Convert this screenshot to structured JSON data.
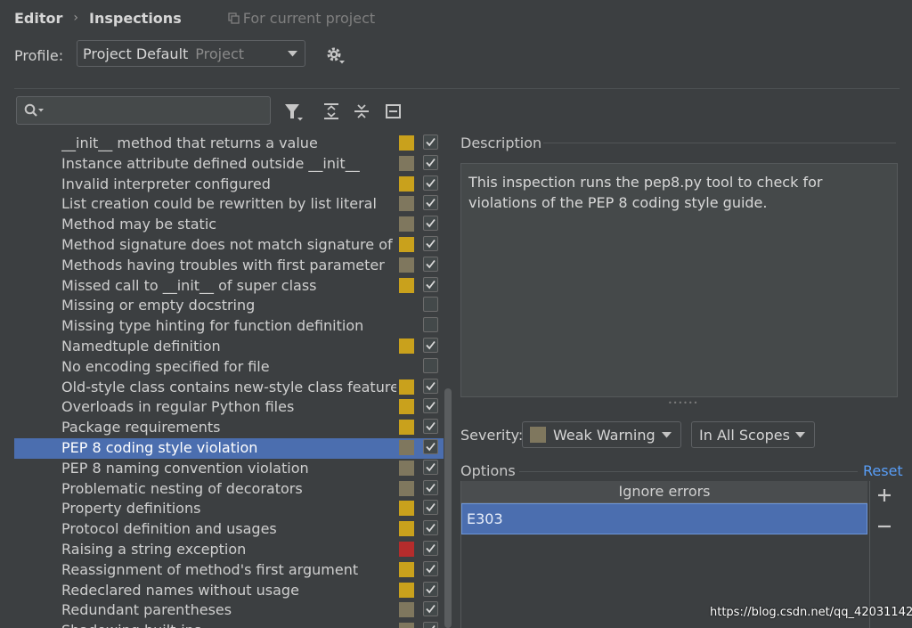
{
  "breadcrumb": {
    "editor": "Editor",
    "inspections": "Inspections",
    "scope_note": "For current project"
  },
  "profile": {
    "label": "Profile:",
    "value": "Project Default",
    "scope": "Project"
  },
  "search": {
    "placeholder": ""
  },
  "toolbar": {
    "icons": [
      "filter-icon",
      "expand-all-icon",
      "collapse-all-icon",
      "reset-icon"
    ]
  },
  "colors": {
    "warning": "#c9a11c",
    "weak_warning": "#7f775e",
    "error": "#b52c2c",
    "selection": "#4b6eaf",
    "link": "#589df6"
  },
  "inspections": [
    {
      "label": "__init__ method that returns a value",
      "severity": "warning",
      "checked": true
    },
    {
      "label": "Instance attribute defined outside __init__",
      "severity": "weak_warning",
      "checked": true
    },
    {
      "label": "Invalid interpreter configured",
      "severity": "warning",
      "checked": true
    },
    {
      "label": "List creation could be rewritten by list literal",
      "severity": "weak_warning",
      "checked": true
    },
    {
      "label": "Method may be static",
      "severity": "weak_warning",
      "checked": true
    },
    {
      "label": "Method signature does not match signature of o",
      "severity": "warning",
      "checked": true
    },
    {
      "label": "Methods having troubles with first parameter",
      "severity": "weak_warning",
      "checked": true
    },
    {
      "label": "Missed call to __init__ of super class",
      "severity": "warning",
      "checked": true
    },
    {
      "label": "Missing or empty docstring",
      "severity": "none",
      "checked": false
    },
    {
      "label": "Missing type hinting for function definition",
      "severity": "none",
      "checked": false
    },
    {
      "label": "Namedtuple definition",
      "severity": "warning",
      "checked": true
    },
    {
      "label": "No encoding specified for file",
      "severity": "none",
      "checked": false
    },
    {
      "label": "Old-style class contains new-style class features",
      "severity": "warning",
      "checked": true
    },
    {
      "label": "Overloads in regular Python files",
      "severity": "warning",
      "checked": true
    },
    {
      "label": "Package requirements",
      "severity": "warning",
      "checked": true
    },
    {
      "label": "PEP 8 coding style violation",
      "severity": "weak_warning",
      "checked": true,
      "selected": true
    },
    {
      "label": "PEP 8 naming convention violation",
      "severity": "weak_warning",
      "checked": true
    },
    {
      "label": "Problematic nesting of decorators",
      "severity": "weak_warning",
      "checked": true
    },
    {
      "label": "Property definitions",
      "severity": "warning",
      "checked": true
    },
    {
      "label": "Protocol definition and usages",
      "severity": "warning",
      "checked": true
    },
    {
      "label": "Raising a string exception",
      "severity": "error",
      "checked": true
    },
    {
      "label": "Reassignment of method's first argument",
      "severity": "warning",
      "checked": true
    },
    {
      "label": "Redeclared names without usage",
      "severity": "warning",
      "checked": true
    },
    {
      "label": "Redundant parentheses",
      "severity": "weak_warning",
      "checked": true
    },
    {
      "label": "Shadowing built-ins",
      "severity": "weak_warning",
      "checked": true
    }
  ],
  "description": {
    "title": "Description",
    "text": "This inspection runs the pep8.py tool to check for violations of the PEP 8 coding style guide."
  },
  "severity": {
    "label": "Severity:",
    "value": "Weak Warning",
    "scope": "In All Scopes"
  },
  "options": {
    "title": "Options",
    "reset": "Reset",
    "ignore_header": "Ignore errors",
    "ignore_items": [
      "E303"
    ]
  },
  "watermark": "https://blog.csdn.net/qq_42031142"
}
